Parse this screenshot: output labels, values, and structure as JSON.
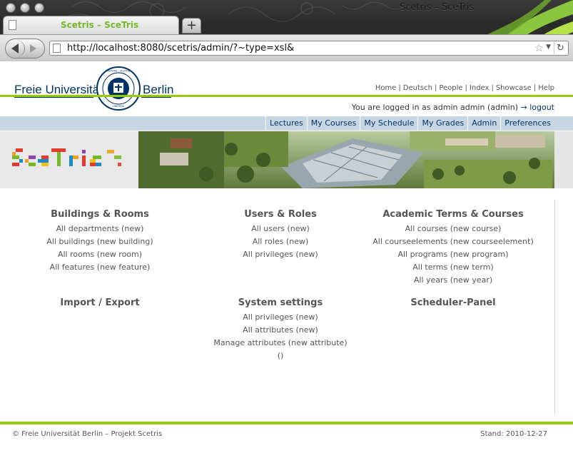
{
  "browser": {
    "window_title": "Scetris – SceTris",
    "tab_title": "Scetris – SceTris",
    "new_tab_label": "+",
    "url": "http://localhost:8080/scetris/admin/?~type=xsl&"
  },
  "header": {
    "university_left": "Freie Universität",
    "university_right": "Berlin",
    "seal_alt": "Freie Universität Berlin seal",
    "top_links": [
      "Home",
      "Deutsch",
      "People",
      "Index",
      "Showcase",
      "Help"
    ],
    "login_text": "You are logged in as admin admin (admin)",
    "logout_label": "→ logout"
  },
  "menu": [
    "Lectures",
    "My Courses",
    "My Schedule",
    "My Grades",
    "Admin",
    "Preferences"
  ],
  "sections": {
    "buildings": {
      "title": "Buildings & Rooms",
      "rows": [
        {
          "text": "All departments",
          "new": "new"
        },
        {
          "text": "All buildings",
          "new": "new building"
        },
        {
          "text": "All rooms",
          "new": "new room"
        },
        {
          "text": "All features",
          "new": "new feature"
        }
      ]
    },
    "users": {
      "title": "Users & Roles",
      "rows": [
        {
          "text": "All users",
          "new": "new"
        },
        {
          "text": "All roles",
          "new": "new"
        },
        {
          "text": "All privileges",
          "new": "new"
        }
      ]
    },
    "academic": {
      "title": "Academic Terms & Courses",
      "rows": [
        {
          "text": "All courses",
          "new": "new course"
        },
        {
          "text": "All courseelements",
          "new": "new courseelement"
        },
        {
          "text": "All programs",
          "new": "new program"
        },
        {
          "text": "All terms",
          "new": "new term"
        },
        {
          "text": "All years",
          "new": "new year"
        }
      ]
    },
    "import": {
      "title": "Import / Export"
    },
    "system": {
      "title": "System settings",
      "rows": [
        {
          "text": "All privileges",
          "new": "new"
        },
        {
          "text": "All attributes",
          "new": "new"
        },
        {
          "text": "Manage attributes",
          "new": "new attribute"
        }
      ],
      "extra": "()"
    },
    "scheduler": {
      "title": "Scheduler-Panel"
    }
  },
  "footer": {
    "left": "© Freie Universität Berlin – Projekt Scetris",
    "right": "Stand: 2010-12-27"
  },
  "colors": {
    "accent_green": "#99cc00",
    "fu_blue": "#003366",
    "menu_bg": "#c8d6e4"
  }
}
